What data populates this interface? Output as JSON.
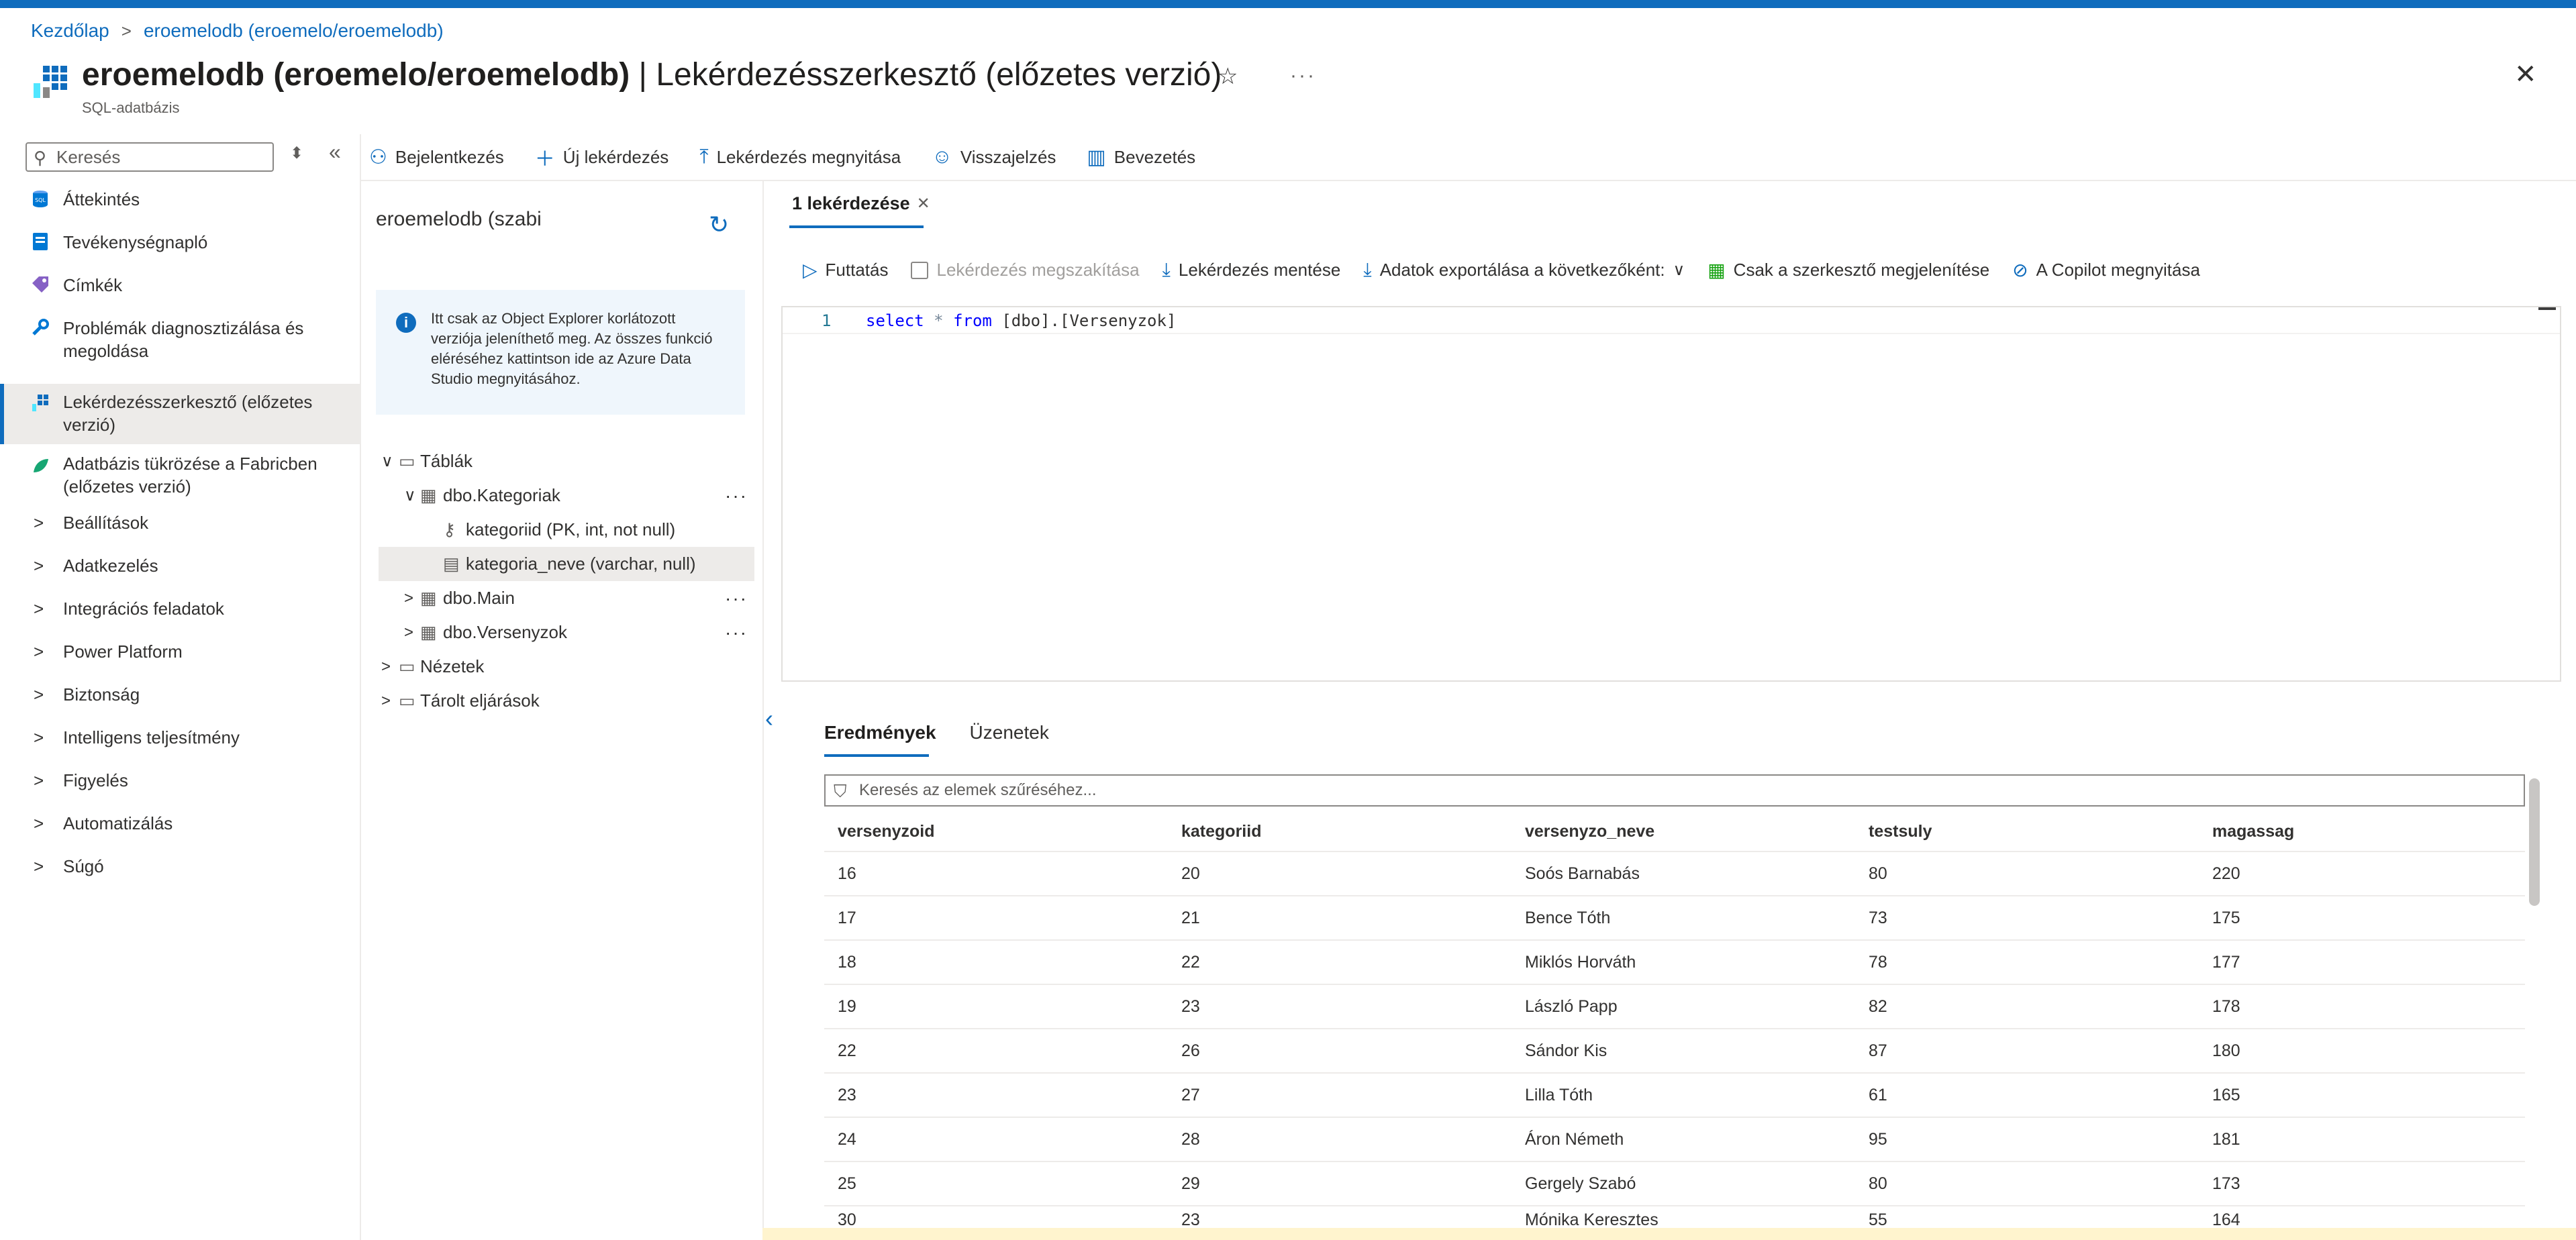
{
  "breadcrumb": {
    "home": "Kezdőlap",
    "current": "eroemelodb (eroemelo/eroemelodb)"
  },
  "header": {
    "title_main": "eroemelodb (eroemelo/eroemelodb)",
    "title_sep": " | ",
    "title_page": "Lekérdezésszerkesztő (előzetes verzió)",
    "subtitle": "SQL-adatbázis",
    "star": "☆",
    "more": "···",
    "close": "✕"
  },
  "nav": {
    "search_placeholder": "Keresés",
    "items": [
      {
        "label": "Áttekintés"
      },
      {
        "label": "Tevékenységnapló"
      },
      {
        "label": "Címkék"
      },
      {
        "label": "Problémák diagnosztizálása és megoldása"
      },
      {
        "label": "Lekérdezésszerkesztő (előzetes verzió)"
      },
      {
        "label": "Adatbázis tükrözése a Fabricben (előzetes verzió)"
      },
      {
        "label": "Beállítások"
      },
      {
        "label": "Adatkezelés"
      },
      {
        "label": "Integrációs feladatok"
      },
      {
        "label": "Power Platform"
      },
      {
        "label": "Biztonság"
      },
      {
        "label": "Intelligens teljesítmény"
      },
      {
        "label": "Figyelés"
      },
      {
        "label": "Automatizálás"
      },
      {
        "label": "Súgó"
      }
    ]
  },
  "toolbar": {
    "login": "Bejelentkezés",
    "new_query": "Új lekérdezés",
    "open_query": "Lekérdezés megnyitása",
    "feedback": "Visszajelzés",
    "intro": "Bevezetés"
  },
  "explorer": {
    "db": "eroemelodb (szabi",
    "info": "Itt csak az Object Explorer korlátozott verziója jeleníthető meg. Az összes funkció eléréséhez kattintson ide az Azure Data Studio megnyitásához.",
    "tree": {
      "tables": "Táblák",
      "t1": "dbo.Kategoriak",
      "t1c1": "kategoriid (PK, int, not null)",
      "t1c2": "kategoria_neve (varchar, null)",
      "t2": "dbo.Main",
      "t3": "dbo.Versenyzok",
      "views": "Nézetek",
      "procs": "Tárolt eljárások",
      "more": "···"
    }
  },
  "editor": {
    "tab": "1 lekérdezése",
    "run": "Futtatás",
    "cancel": "Lekérdezés megszakítása",
    "save": "Lekérdezés mentése",
    "export": "Adatok exportálása a következőként:",
    "editor_only": "Csak a szerkesztő megjelenítése",
    "copilot": "A Copilot megnyitása",
    "line_no": "1",
    "code": {
      "kw1": "select",
      "star": "*",
      "kw2": "from",
      "rest": "[dbo].[Versenyzok]"
    }
  },
  "results": {
    "tab_results": "Eredmények",
    "tab_messages": "Üzenetek",
    "filter_placeholder": "Keresés az elemek szűréséhez...",
    "columns": [
      "versenyzoid",
      "kategoriid",
      "versenyzo_neve",
      "testsuly",
      "magassag"
    ],
    "rows": [
      [
        "16",
        "20",
        "Soós Barnabás",
        "80",
        "220"
      ],
      [
        "17",
        "21",
        "Bence Tóth",
        "73",
        "175"
      ],
      [
        "18",
        "22",
        "Miklós Horváth",
        "78",
        "177"
      ],
      [
        "19",
        "23",
        "László Papp",
        "82",
        "178"
      ],
      [
        "22",
        "26",
        "Sándor Kis",
        "87",
        "180"
      ],
      [
        "23",
        "27",
        "Lilla Tóth",
        "61",
        "165"
      ],
      [
        "24",
        "28",
        "Áron Németh",
        "95",
        "181"
      ],
      [
        "25",
        "29",
        "Gergely Szabó",
        "80",
        "173"
      ],
      [
        "30",
        "23",
        "Mónika Keresztes",
        "55",
        "164"
      ]
    ]
  },
  "colors": {
    "accent": "#0f6cbd",
    "selected_bg": "#edebe9",
    "info_bg": "#eff6fc"
  }
}
